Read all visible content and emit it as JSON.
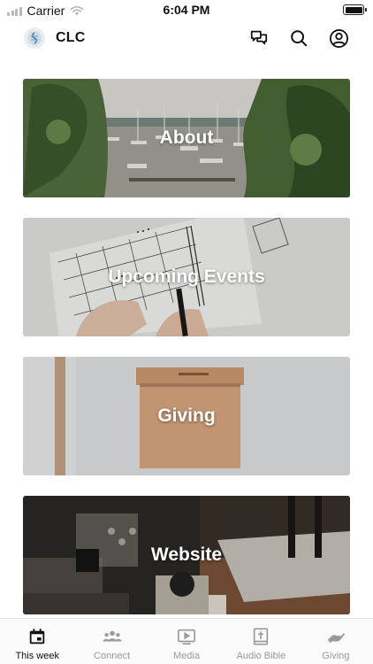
{
  "status_bar": {
    "carrier": "Carrier",
    "time": "6:04 PM"
  },
  "header": {
    "title": "CLC",
    "icons": [
      "chat-icon",
      "search-icon",
      "account-icon"
    ]
  },
  "cards": [
    {
      "label": "About"
    },
    {
      "label": "Upcoming Events"
    },
    {
      "label": "Giving"
    },
    {
      "label": "Website"
    }
  ],
  "tabs": [
    {
      "label": "This week",
      "icon": "calendar-icon",
      "active": true
    },
    {
      "label": "Connect",
      "icon": "group-icon",
      "active": false
    },
    {
      "label": "Media",
      "icon": "play-icon",
      "active": false
    },
    {
      "label": "Audio Bible",
      "icon": "bible-icon",
      "active": false
    },
    {
      "label": "Giving",
      "icon": "giving-hand-icon",
      "active": false
    }
  ],
  "colors": {
    "active_tab": "#111111",
    "inactive_tab": "#9a9a9a"
  }
}
